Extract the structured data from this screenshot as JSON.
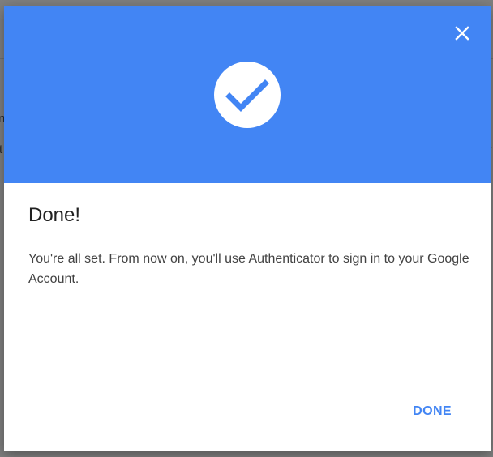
{
  "dialog": {
    "close_icon": "close-icon",
    "hero_icon": "check-circle-icon",
    "title": "Done!",
    "message": "You're all set. From now on, you'll use Authenticator to sign in to your Google Account.",
    "done_label": "DONE"
  },
  "colors": {
    "header_bg": "#4285f4",
    "accent": "#4285f4",
    "title": "#212121",
    "message": "#424242"
  },
  "backdrop": {
    "left_glyph_1": "n",
    "left_glyph_2": "t",
    "right_glyph": "r"
  }
}
